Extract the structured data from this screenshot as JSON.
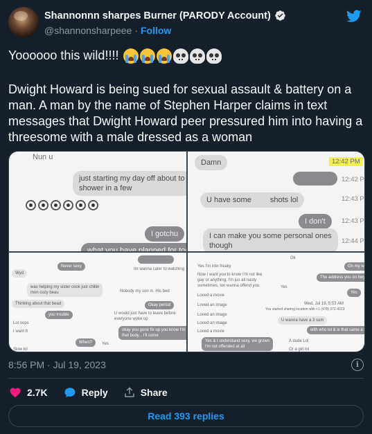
{
  "author": {
    "display_name": "Shannonnn sharpes Burner (PARODY Account)",
    "handle": "@shannonsharpeee",
    "follow_label": "Follow",
    "dot_separator": "·"
  },
  "tweet": {
    "line1_text": "Yoooooo this wild!!!!",
    "line1_emojis": [
      "loudly-crying-face",
      "loudly-crying-face",
      "loudly-crying-face",
      "skull",
      "skull",
      "skull"
    ],
    "body": "Dwight Howard is being sued for sexual assault & battery on a man. A man by the name of Stephen Harper claims in text messages that Dwight Howard peer pressured him into having a threesome with a male dressed as a woman",
    "timestamp": "8:56 PM · Jul 19, 2023"
  },
  "media": {
    "p1": {
      "top_label": "Nun u",
      "bubble1_line1": "just starting my day off about to",
      "bubble1_line2": "shower in a few",
      "bubble2": "I gotchu",
      "bubble3": "what you have planned for today ?"
    },
    "p2": {
      "msg_damn": "Damn",
      "ts1": "12:42 PM",
      "ts2": "12:42 PM",
      "msg_u_have": "U have some",
      "msg_shots": "shots lol",
      "ts3": "12:43 PM",
      "msg_idont": "I don't",
      "ts4": "12:43 PM",
      "msg_make_line1": "I can make you some personal ones",
      "msg_make_line2": "though",
      "ts5": "12:44 PM"
    },
    "p3": {
      "m1": "Never sexy",
      "m2": "Wyd",
      "m3": "Im wanna cater to watching",
      "m4": "was helping my sister cook just chillin",
      "m5": "mon cozy beau",
      "m6": "Nobody my son in. His bed",
      "m7": "Thinking about that bead",
      "m8": "Okay period",
      "m9": "you trouble",
      "m10": "U would just have to leave before",
      "m11": "everyone woke up",
      "m12": "Lol oops",
      "m13": "I want It",
      "m14": "okay you gone fix up you know I'm on",
      "m15": "that body... I'll come",
      "m16": "When?",
      "m17": "Yes",
      "m18": "Slow lol"
    },
    "p4": {
      "m1": "Ok",
      "m2": "Yes I'm into freaky",
      "m3": "On my way",
      "m4": "Now I want you to know I'm not like",
      "m5": "gay or anything, I'm jus all nasty",
      "m6": "sometimes, lon wanna offend you",
      "m7": "The address you on hwy right?",
      "m8": "Loved a movie",
      "m9": "Yes",
      "m10": "Loved an image",
      "m11": "Yes",
      "m12": "Loved an image",
      "m13": "Wed, Jul 19, 5:53 AM",
      "m14": "You started sharing location with +1 (478) 372-4223",
      "m15": "Loved an image",
      "m16": "U wanna have a 3 sum",
      "m17": "Loved a movie",
      "m18": "with who lol & is that same a super?",
      "m19": "Yes & I understand sexy, we grown",
      "m20": "I'm not offended at all",
      "m21": "A dude Lol",
      "m22": "Or a girl lol"
    }
  },
  "actions": {
    "like_count": "2.7K",
    "reply_label": "Reply",
    "share_label": "Share",
    "read_replies": "Read 393 replies"
  },
  "colors": {
    "background": "#15202b",
    "accent": "#1d9bf0",
    "like": "#f91880",
    "secondary_text": "#8b98a5"
  }
}
